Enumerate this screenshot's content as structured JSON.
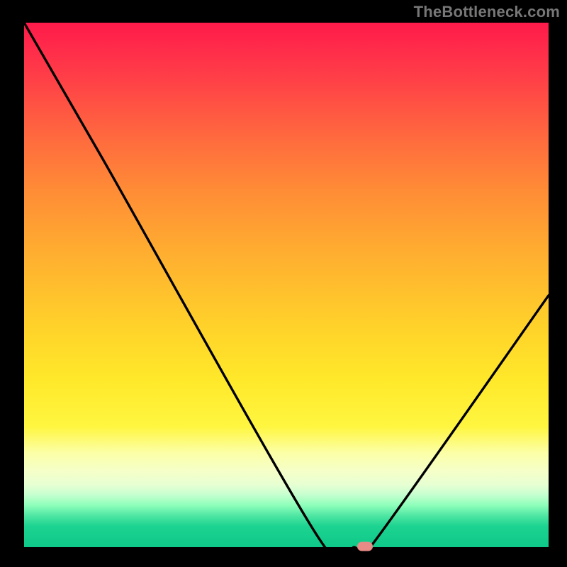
{
  "watermark": "TheBottleneck.com",
  "colors": {
    "frame": "#000000",
    "curve": "#000000",
    "marker": "#e88a86",
    "gradient_top": "#ff1a4b",
    "gradient_bottom": "#0ec989"
  },
  "chart_data": {
    "type": "line",
    "title": "",
    "xlabel": "",
    "ylabel": "",
    "xlim": [
      0,
      100
    ],
    "ylim": [
      0,
      100
    ],
    "series": [
      {
        "name": "bottleneck-curve",
        "x": [
          0,
          15,
          56,
          63,
          66,
          100
        ],
        "values": [
          100,
          74,
          2,
          0,
          0,
          48
        ]
      }
    ],
    "marker": {
      "x": 65,
      "y": 0
    },
    "annotations": []
  },
  "elements": {
    "plot": {
      "name": "bottleneck-plot",
      "interactable": false
    },
    "marker": {
      "name": "bottleneck-marker",
      "interactable": false
    },
    "curve": {
      "name": "bottleneck-curve",
      "interactable": false
    }
  }
}
